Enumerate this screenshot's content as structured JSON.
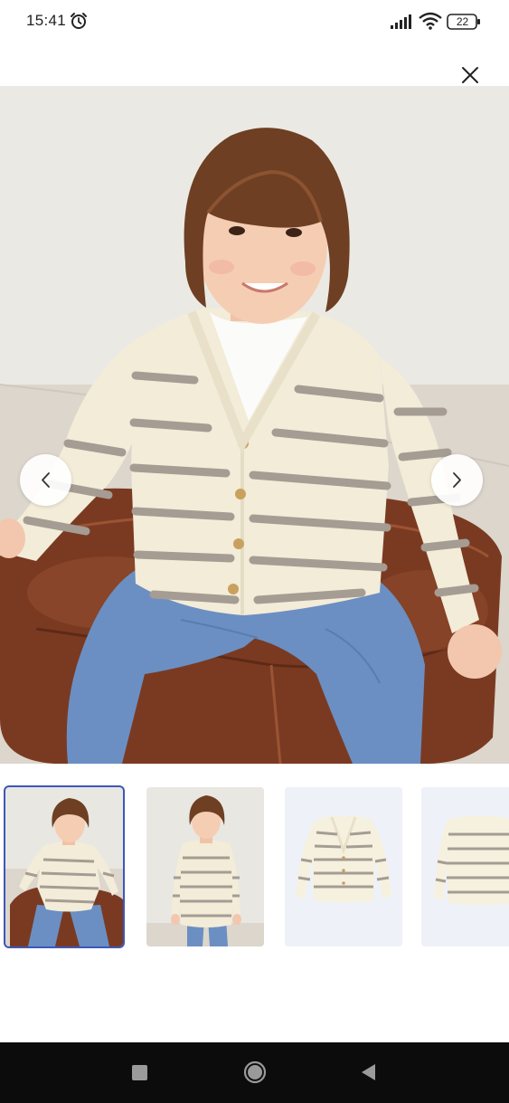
{
  "status_bar": {
    "time": "15:41",
    "battery_level": "22",
    "icons": [
      "alarm-icon",
      "signal-icon",
      "wifi-icon",
      "battery-icon"
    ]
  },
  "toolbar": {
    "close_icon": "close-icon"
  },
  "gallery": {
    "main_image": "child-striped-cardigan-seated-photo",
    "prev_icon": "chevron-left-icon",
    "next_icon": "chevron-right-icon",
    "selected_index": 0,
    "thumbnails": [
      {
        "name": "thumbnail-seated-child",
        "selected": true
      },
      {
        "name": "thumbnail-standing-child",
        "selected": false
      },
      {
        "name": "thumbnail-cardigan-front",
        "selected": false
      },
      {
        "name": "thumbnail-cardigan-back",
        "selected": false
      }
    ]
  },
  "colors": {
    "selected_outline": "#3d57b8",
    "cardigan_cream": "#f2ecd8",
    "stripe_taupe": "#a59c93",
    "jeans_blue": "#6b8fc2",
    "leather_brown": "#7a3a22",
    "nav_bar": "#0c0c0c"
  },
  "system_nav": {
    "icons": [
      "recent-apps-icon",
      "home-icon",
      "back-icon"
    ]
  }
}
